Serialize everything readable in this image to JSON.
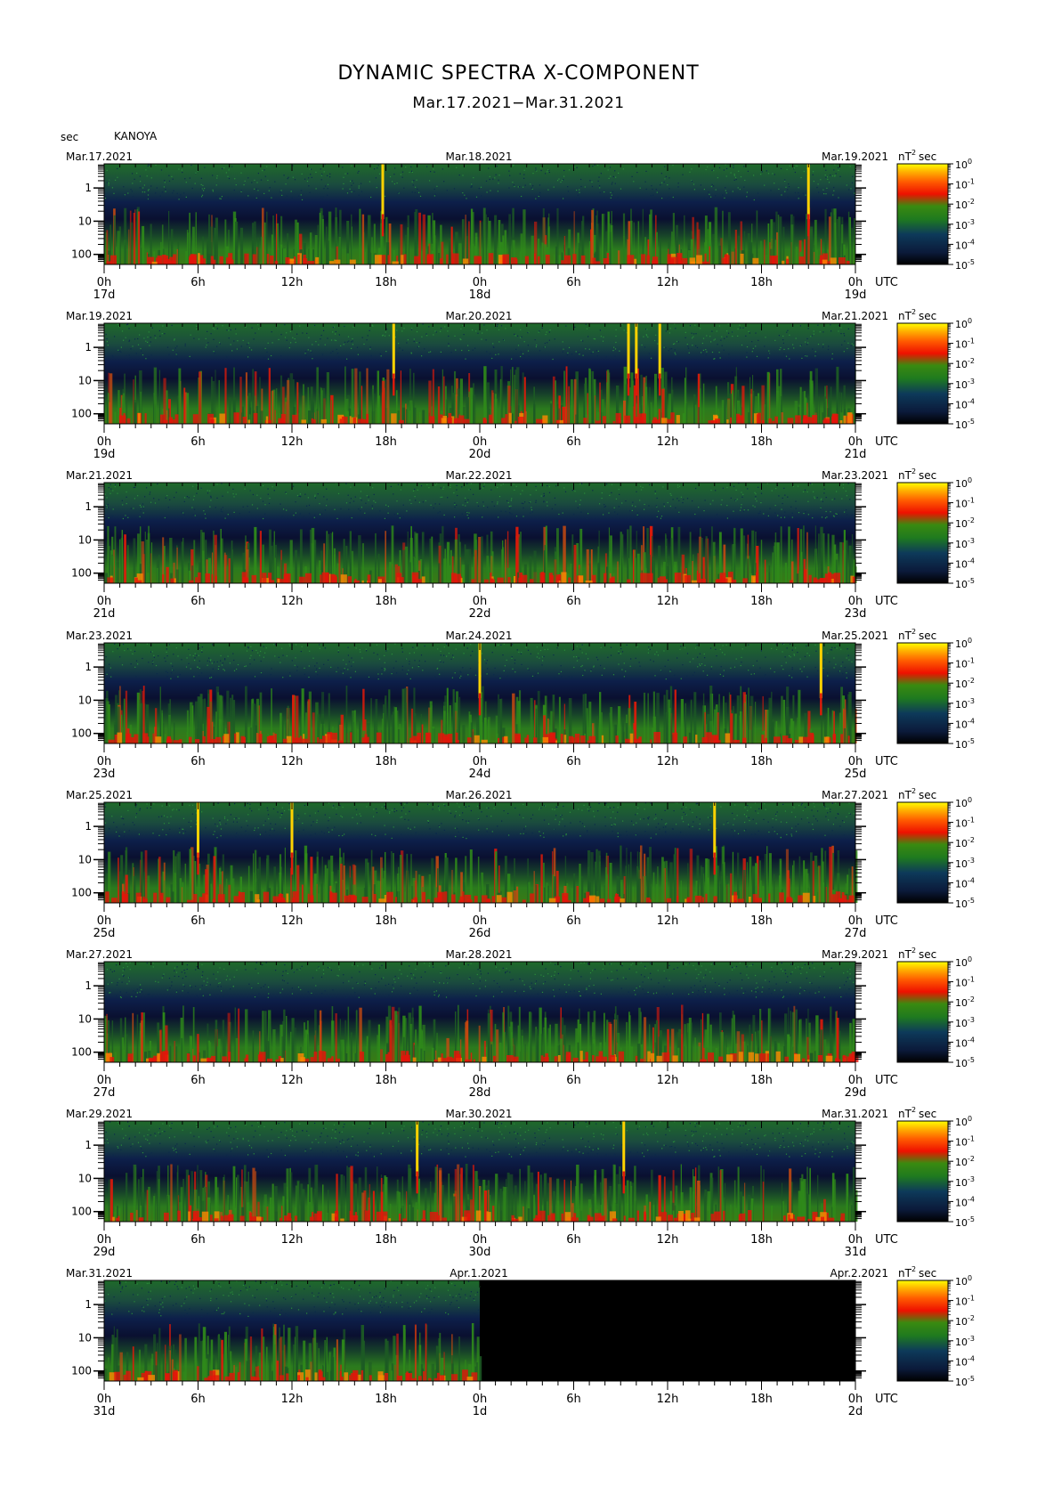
{
  "title": "DYNAMIC SPECTRA X-COMPONENT",
  "subtitle": "Mar.17.2021−Mar.31.2021",
  "y_unit_label": "sec",
  "station": "KANOYA",
  "unit_label": "nT",
  "unit_sup": "2",
  "unit_suffix": "sec",
  "chart_data": {
    "type": "heatmap",
    "y_axis": {
      "label": "sec",
      "scale": "log",
      "tick_labels": [
        "1",
        "10",
        "100"
      ]
    },
    "x_tick_labels": [
      "0h",
      "6h",
      "12h",
      "18h",
      "0h",
      "6h",
      "12h",
      "18h",
      "0h"
    ],
    "x_axis_unit": "UTC",
    "colorbar": {
      "label": "nT²sec",
      "scale": "log",
      "tick_labels": [
        "10^0",
        "10^-1",
        "10^-2",
        "10^-3",
        "10^-4",
        "10^-5"
      ],
      "colors": [
        "#ffff00",
        "#ff6600",
        "#ee1100",
        "#228b22",
        "#0b1a3a",
        "#000000"
      ]
    },
    "panels": [
      {
        "left_date": "Mar.17.2021",
        "mid_date": "Mar.18.2021",
        "right_date": "Mar.19.2021",
        "day_labels": [
          "17d",
          "18d",
          "19d"
        ],
        "events_hours": [
          17.8,
          45.0
        ],
        "data_coverage_hours": 48
      },
      {
        "left_date": "Mar.19.2021",
        "mid_date": "Mar.20.2021",
        "right_date": "Mar.21.2021",
        "day_labels": [
          "19d",
          "20d",
          "21d"
        ],
        "events_hours": [
          18.5,
          33.5,
          34.0,
          35.5
        ],
        "data_coverage_hours": 48
      },
      {
        "left_date": "Mar.21.2021",
        "mid_date": "Mar.22.2021",
        "right_date": "Mar.23.2021",
        "day_labels": [
          "21d",
          "22d",
          "23d"
        ],
        "events_hours": [],
        "data_coverage_hours": 48
      },
      {
        "left_date": "Mar.23.2021",
        "mid_date": "Mar.24.2021",
        "right_date": "Mar.25.2021",
        "day_labels": [
          "23d",
          "24d",
          "25d"
        ],
        "events_hours": [
          24.0,
          45.8
        ],
        "data_coverage_hours": 48
      },
      {
        "left_date": "Mar.25.2021",
        "mid_date": "Mar.26.2021",
        "right_date": "Mar.27.2021",
        "day_labels": [
          "25d",
          "26d",
          "27d"
        ],
        "events_hours": [
          6.0,
          12.0,
          39.0
        ],
        "data_coverage_hours": 48
      },
      {
        "left_date": "Mar.27.2021",
        "mid_date": "Mar.28.2021",
        "right_date": "Mar.29.2021",
        "day_labels": [
          "27d",
          "28d",
          "29d"
        ],
        "events_hours": [],
        "data_coverage_hours": 48
      },
      {
        "left_date": "Mar.29.2021",
        "mid_date": "Mar.30.2021",
        "right_date": "Mar.31.2021",
        "day_labels": [
          "29d",
          "30d",
          "31d"
        ],
        "events_hours": [
          20.0,
          33.2
        ],
        "data_coverage_hours": 48
      },
      {
        "left_date": "Mar.31.2021",
        "mid_date": "Apr.1.2021",
        "right_date": "Apr.2.2021",
        "day_labels": [
          "31d",
          "1d",
          "2d"
        ],
        "events_hours": [],
        "data_coverage_hours": 24
      }
    ]
  }
}
